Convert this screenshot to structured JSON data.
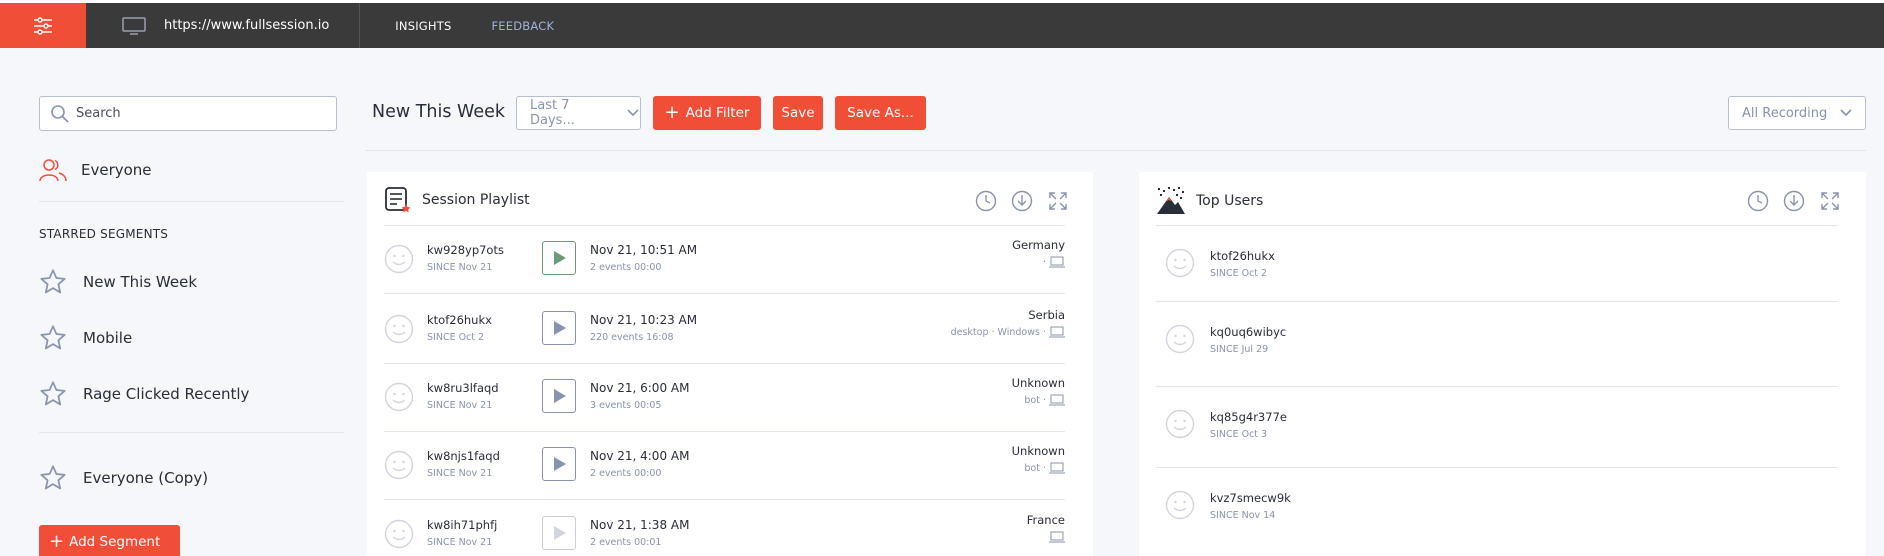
{
  "header": {
    "url": "https://www.fullsession.io",
    "nav": [
      {
        "label": "INSIGHTS"
      },
      {
        "label": "FEEDBACK"
      }
    ]
  },
  "sidebar": {
    "search_placeholder": "Search",
    "everyone_label": "Everyone",
    "starred_title": "STARRED SEGMENTS",
    "segments": [
      {
        "label": "New This Week"
      },
      {
        "label": "Mobile"
      },
      {
        "label": "Rage Clicked Recently"
      },
      {
        "label": "Everyone (Copy)"
      }
    ],
    "add_segment_label": "Add Segment"
  },
  "toolbar": {
    "title": "New This Week",
    "date_range": "Last 7 Days...",
    "add_filter_label": "Add Filter",
    "save_label": "Save",
    "save_as_label": "Save As...",
    "recording_filter": "All Recording"
  },
  "session_playlist": {
    "title": "Session Playlist",
    "rows": [
      {
        "user": "kw928yp7ots",
        "since": "SINCE Nov 21",
        "date": "Nov 21, 10:51 AM",
        "meta": "2 events  00:00",
        "country": "Germany",
        "device": "·"
      },
      {
        "user": "ktof26hukx",
        "since": "SINCE Oct 2",
        "date": "Nov 21, 10:23 AM",
        "meta": "220 events  16:08",
        "country": "Serbia",
        "device": "desktop · Windows ·"
      },
      {
        "user": "kw8ru3lfaqd",
        "since": "SINCE Nov 21",
        "date": "Nov 21, 6:00 AM",
        "meta": "3 events  00:05",
        "country": "Unknown",
        "device": "bot ·"
      },
      {
        "user": "kw8njs1faqd",
        "since": "SINCE Nov 21",
        "date": "Nov 21, 4:00 AM",
        "meta": "2 events  00:00",
        "country": "Unknown",
        "device": "bot ·"
      },
      {
        "user": "kw8ih71phfj",
        "since": "SINCE Nov 21",
        "date": "Nov 21, 1:38 AM",
        "meta": "2 events  00:01",
        "country": "France",
        "device": ""
      }
    ]
  },
  "top_users": {
    "title": "Top Users",
    "rows": [
      {
        "user": "ktof26hukx",
        "since": "SINCE Oct 2"
      },
      {
        "user": "kq0uq6wibyc",
        "since": "SINCE Jul 29"
      },
      {
        "user": "kq85g4r377e",
        "since": "SINCE Oct 3"
      },
      {
        "user": "kvz7smecw9k",
        "since": "SINCE Nov 14"
      }
    ]
  },
  "colors": {
    "accent": "#f04e37",
    "topbar": "#3a3a3a",
    "muted": "#8a93ad",
    "play_active": "#6a9a7a"
  }
}
